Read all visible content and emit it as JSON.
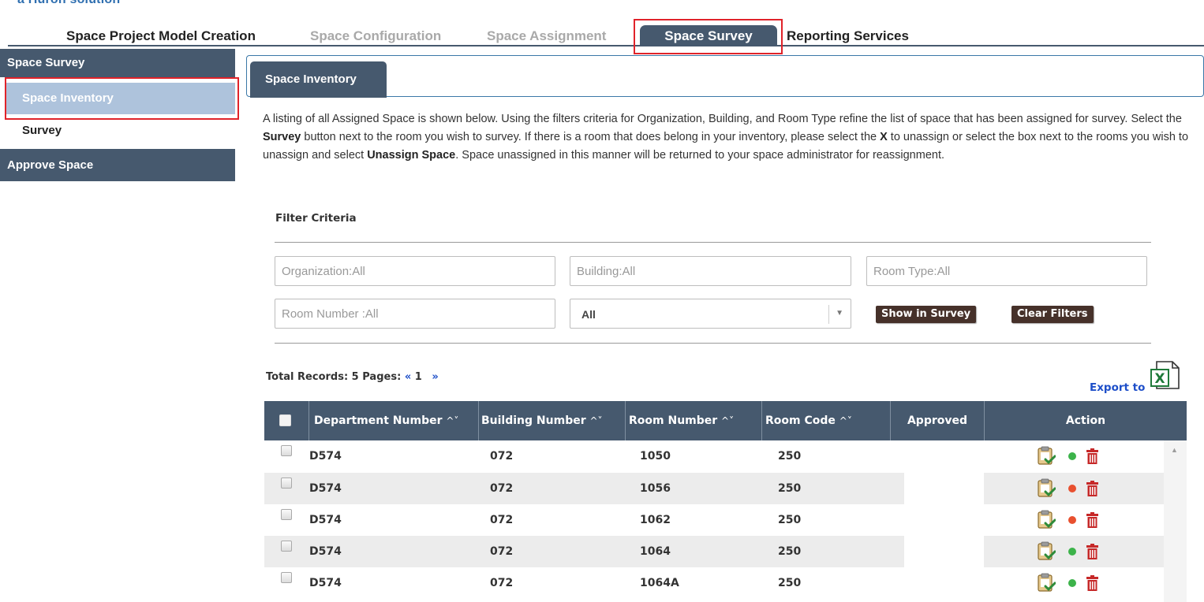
{
  "brand_partial": "a Huron solution",
  "top_nav": {
    "items": [
      {
        "label": "Space Project Model Creation",
        "state": "normal"
      },
      {
        "label": "Space Configuration",
        "state": "dim"
      },
      {
        "label": "Space Assignment",
        "state": "dim"
      },
      {
        "label": "Space Survey",
        "state": "active"
      },
      {
        "label": "Reporting Services",
        "state": "normal"
      }
    ]
  },
  "sidebar": {
    "section1": "Space Survey",
    "items": [
      {
        "label": "Space Inventory",
        "selected": true
      },
      {
        "label": "Survey",
        "selected": false
      }
    ],
    "section2": "Approve Space"
  },
  "panel": {
    "tab": "Space Inventory",
    "description": {
      "part1": "A listing of all Assigned Space is shown below. Using the filters criteria for Organization, Building, and Room Type refine the list of space that has been assigned for survey. Select the ",
      "bold1": "Survey",
      "part2": " button next to the room you wish to survey. If there is a room that does belong in your inventory, please select the ",
      "bold2": "X",
      "part3": " to unassign or select the box next to the rooms you wish to unassign and select ",
      "bold3": "Unassign Space",
      "part4": ". Space unassigned in this manner will be returned to your space administrator for reassignment."
    }
  },
  "filters": {
    "title": "Filter Criteria",
    "organization_placeholder": "Organization:All",
    "building_placeholder": "Building:All",
    "room_type_placeholder": "Room Type:All",
    "room_number_placeholder": "Room Number :All",
    "select_value": "All",
    "show_button": "Show in Survey",
    "clear_button": "Clear Filters"
  },
  "records": {
    "label": "Total Records: 5  Pages:",
    "prev": "«",
    "page": "1",
    "next": "»",
    "export": "Export to"
  },
  "table": {
    "columns": [
      "Department Number",
      "Building Number",
      "Room Number",
      "Room Code",
      "Approved",
      "Action"
    ],
    "sort_glyph": "^˅",
    "rows": [
      {
        "dept": "D574",
        "building": "072",
        "room": "1050",
        "code": "250",
        "approved": "",
        "status": "green"
      },
      {
        "dept": "D574",
        "building": "072",
        "room": "1056",
        "code": "250",
        "approved": "",
        "status": "red"
      },
      {
        "dept": "D574",
        "building": "072",
        "room": "1062",
        "code": "250",
        "approved": "",
        "status": "red"
      },
      {
        "dept": "D574",
        "building": "072",
        "room": "1064",
        "code": "250",
        "approved": "",
        "status": "green"
      },
      {
        "dept": "D574",
        "building": "072",
        "room": "1064A",
        "code": "250",
        "approved": "",
        "status": "green"
      }
    ]
  },
  "colors": {
    "nav_dark": "#46596e",
    "highlight": "#e0232a",
    "link_blue": "#1e4fc9",
    "button_brown": "#46312a",
    "status_green": "#3cb34a",
    "status_red": "#e8502f",
    "delete_red": "#c62828"
  }
}
